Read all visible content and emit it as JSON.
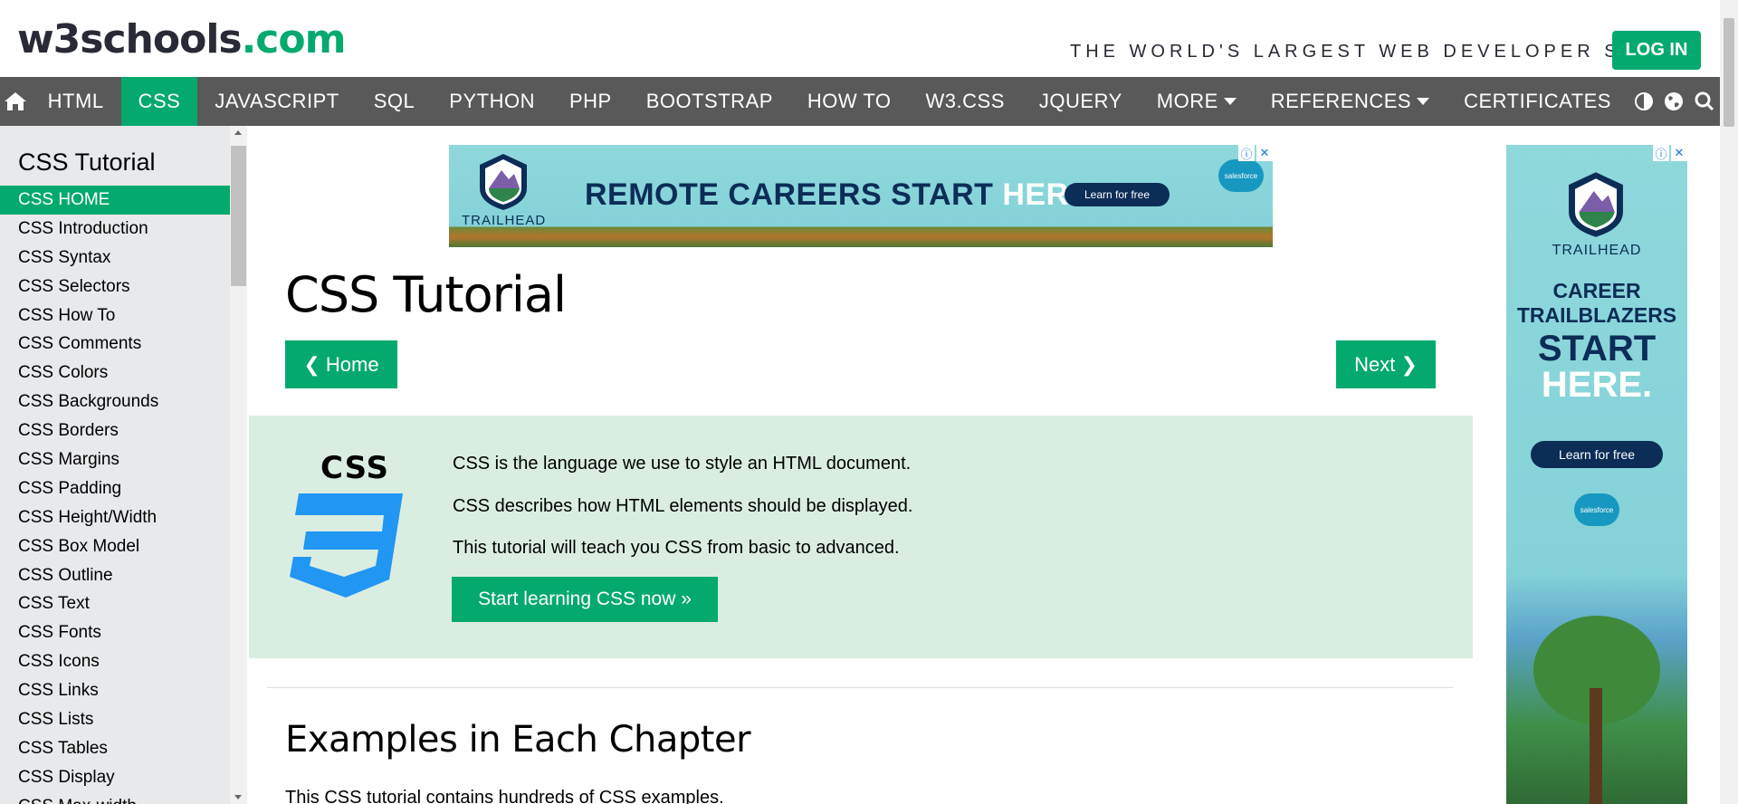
{
  "header": {
    "logo_main": "w3schools",
    "logo_suffix": ".com",
    "tagline": "THE WORLD'S LARGEST WEB DEVELOPER SITE",
    "login_label": "LOG IN"
  },
  "nav": {
    "items": [
      {
        "label": "HTML"
      },
      {
        "label": "CSS",
        "active": true
      },
      {
        "label": "JAVASCRIPT"
      },
      {
        "label": "SQL"
      },
      {
        "label": "PYTHON"
      },
      {
        "label": "PHP"
      },
      {
        "label": "BOOTSTRAP"
      },
      {
        "label": "HOW TO"
      },
      {
        "label": "W3.CSS"
      },
      {
        "label": "JQUERY"
      },
      {
        "label": "MORE"
      },
      {
        "label": "REFERENCES"
      },
      {
        "label": "CERTIFICATES"
      }
    ],
    "icons": [
      "home-icon",
      "contrast-icon",
      "globe-icon",
      "search-icon"
    ]
  },
  "sidebar": {
    "title": "CSS Tutorial",
    "items": [
      "CSS HOME",
      "CSS Introduction",
      "CSS Syntax",
      "CSS Selectors",
      "CSS How To",
      "CSS Comments",
      "CSS Colors",
      "CSS Backgrounds",
      "CSS Borders",
      "CSS Margins",
      "CSS Padding",
      "CSS Height/Width",
      "CSS Box Model",
      "CSS Outline",
      "CSS Text",
      "CSS Fonts",
      "CSS Icons",
      "CSS Links",
      "CSS Lists",
      "CSS Tables",
      "CSS Display",
      "CSS Max-width"
    ],
    "active_index": 0
  },
  "ads": {
    "top": {
      "brand": "TRAILHEAD",
      "headline_1": "REMOTE CAREERS START",
      "headline_2": "HERE.",
      "cta": "Learn for free",
      "sponsor": "salesforce"
    },
    "right": {
      "brand": "TRAILHEAD",
      "line1": "CAREER",
      "line2": "TRAILBLAZERS",
      "line3": "START",
      "line4": "HERE.",
      "cta": "Learn for free",
      "sponsor": "salesforce"
    }
  },
  "main": {
    "title": "CSS Tutorial",
    "home_button": "❮ Home",
    "next_button": "Next ❯",
    "intro": {
      "logo_text": "CSS",
      "lines": [
        "CSS is the language we use to style an HTML document.",
        "CSS describes how HTML elements should be displayed.",
        "This tutorial will teach you CSS from basic to advanced."
      ],
      "start_button": "Start learning CSS now »"
    },
    "section_title": "Examples in Each Chapter",
    "section_text": "This CSS tutorial contains hundreds of CSS examples."
  },
  "colors": {
    "accent": "#04AA6D",
    "nav_bg": "#595959",
    "sidebar_bg": "#E7E9EB",
    "intro_bg": "#D9EEE1",
    "css_logo": "#2196F3"
  }
}
